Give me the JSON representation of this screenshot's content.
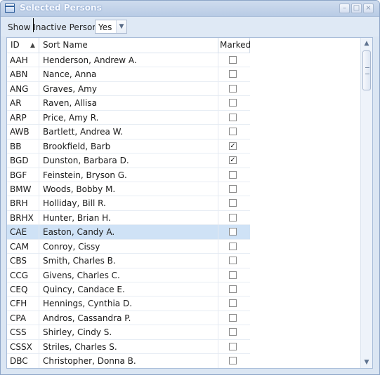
{
  "window": {
    "title": "Selected Persons"
  },
  "window_controls": {
    "minimize": "–",
    "maximize": "□",
    "close": "×"
  },
  "toolbar": {
    "filter_label": "Show Inactive Persons",
    "filter_value": "Yes"
  },
  "grid": {
    "columns": [
      "ID",
      "Sort Name",
      "Marked"
    ],
    "sort_indicator": "▲",
    "rows": [
      {
        "id": "AAH",
        "name": "Henderson, Andrew A.",
        "marked": false
      },
      {
        "id": "ABN",
        "name": "Nance, Anna",
        "marked": false
      },
      {
        "id": "ANG",
        "name": "Graves, Amy",
        "marked": false
      },
      {
        "id": "AR",
        "name": "Raven, Allisa",
        "marked": false
      },
      {
        "id": "ARP",
        "name": "Price, Amy R.",
        "marked": false
      },
      {
        "id": "AWB",
        "name": "Bartlett, Andrea W.",
        "marked": false
      },
      {
        "id": "BB",
        "name": "Brookfield, Barb",
        "marked": true
      },
      {
        "id": "BGD",
        "name": "Dunston, Barbara D.",
        "marked": true
      },
      {
        "id": "BGF",
        "name": "Feinstein, Bryson G.",
        "marked": false
      },
      {
        "id": "BMW",
        "name": "Woods, Bobby M.",
        "marked": false
      },
      {
        "id": "BRH",
        "name": "Holliday, Bill R.",
        "marked": false
      },
      {
        "id": "BRHX",
        "name": "Hunter, Brian H.",
        "marked": false
      },
      {
        "id": "CAE",
        "name": "Easton, Candy A.",
        "marked": false,
        "selected": true
      },
      {
        "id": "CAM",
        "name": "Conroy, Cissy",
        "marked": false
      },
      {
        "id": "CBS",
        "name": "Smith, Charles B.",
        "marked": false
      },
      {
        "id": "CCG",
        "name": "Givens, Charles C.",
        "marked": false
      },
      {
        "id": "CEQ",
        "name": "Quincy, Candace E.",
        "marked": false
      },
      {
        "id": "CFH",
        "name": "Hennings, Cynthia D.",
        "marked": false
      },
      {
        "id": "CPA",
        "name": "Andros, Cassandra P.",
        "marked": false
      },
      {
        "id": "CSS",
        "name": "Shirley, Cindy S.",
        "marked": false
      },
      {
        "id": "CSSX",
        "name": "Striles, Charles S.",
        "marked": false
      },
      {
        "id": "DBC",
        "name": "Christopher, Donna B.",
        "marked": false
      }
    ]
  },
  "scrollbar": {
    "up_icon": "▲",
    "down_icon": "▼"
  },
  "icons": {
    "window_icon": "app-window-icon",
    "dropdown": "chevron-down-icon"
  },
  "colors": {
    "selection": "#cfe2f6",
    "title_bar": "#b8cbe5"
  }
}
